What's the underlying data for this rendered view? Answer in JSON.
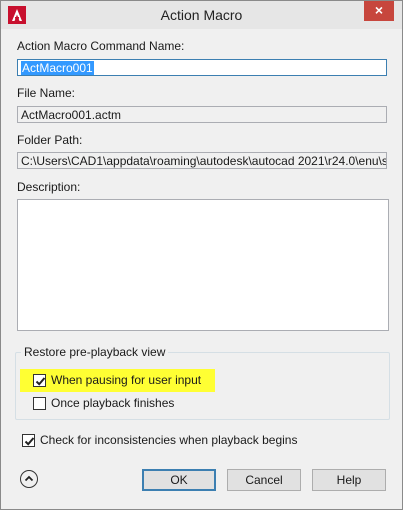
{
  "window": {
    "title": "Action Macro",
    "close_label": "×",
    "app_icon": "autocad-logo-icon"
  },
  "form": {
    "command_name_label": "Action Macro Command Name:",
    "command_name_value": "ActMacro001",
    "file_name_label": "File Name:",
    "file_name_value": "ActMacro001.actm",
    "folder_path_label": "Folder Path:",
    "folder_path_value": "C:\\Users\\CAD1\\appdata\\roaming\\autodesk\\autocad 2021\\r24.0\\enu\\s",
    "description_label": "Description:",
    "description_value": ""
  },
  "restore_group": {
    "label": "Restore pre-playback view",
    "options": [
      {
        "label": "When pausing for user input",
        "checked": true,
        "highlighted": true
      },
      {
        "label": "Once playback finishes",
        "checked": false
      }
    ]
  },
  "inconsistency_check": {
    "label": "Check for inconsistencies when playback begins",
    "checked": true
  },
  "buttons": {
    "ok": "OK",
    "cancel": "Cancel",
    "help": "Help"
  },
  "colors": {
    "highlight": "#ffff33",
    "selection": "#3399ff",
    "close": "#c7463d",
    "brand_red": "#c8102e"
  }
}
